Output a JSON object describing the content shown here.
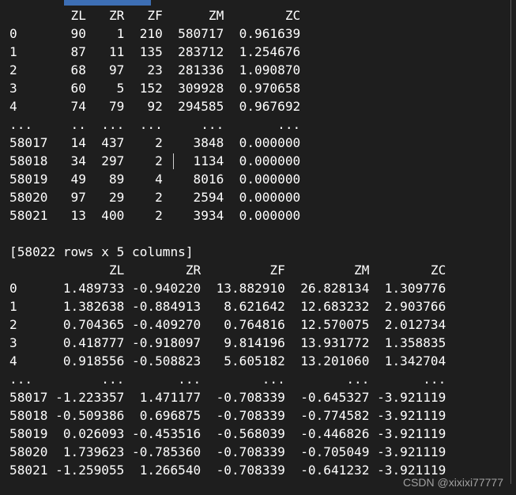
{
  "first_frame": {
    "header": "        ZL   ZR   ZF      ZM        ZC",
    "rows": [
      "0       90    1  210  580717  0.961639",
      "1       87   11  135  283712  1.254676",
      "2       68   97   23  281336  1.090870",
      "3       60    5  152  309928  0.970658",
      "4       74   79   92  294585  0.967692",
      "...     ..  ...  ...     ...       ...",
      "58017   14  437    2    3848  0.000000",
      "58018   34  297    2    1134  0.000000",
      "58019   49   89    4    8016  0.000000",
      "58020   97   29    2    2594  0.000000",
      "58021   13  400    2    3934  0.000000"
    ],
    "summary": "[58022 rows x 5 columns]"
  },
  "second_frame": {
    "header": "             ZL        ZR         ZF         ZM        ZC",
    "rows": [
      "0      1.489733 -0.940220  13.882910  26.828134  1.309776",
      "1      1.382638 -0.884913   8.621642  12.683232  2.903766",
      "2      0.704365 -0.409270   0.764816  12.570075  2.012734",
      "3      0.418777 -0.918097   9.814196  13.931772  1.358835",
      "4      0.918556 -0.508823   5.605182  13.201060  1.342704",
      "...         ...       ...        ...        ...       ...",
      "58017 -1.223357  1.471177  -0.708339  -0.645327 -3.921119",
      "58018 -0.509386  0.696875  -0.708339  -0.774582 -3.921119",
      "58019  0.026093 -0.453516  -0.568039  -0.446826 -3.921119",
      "58020  1.739623 -0.785360  -0.708339  -0.705049 -3.921119",
      "58021 -1.259055  1.266540  -0.708339  -0.641232 -3.921119"
    ]
  },
  "watermark": "CSDN @xixixi77777"
}
